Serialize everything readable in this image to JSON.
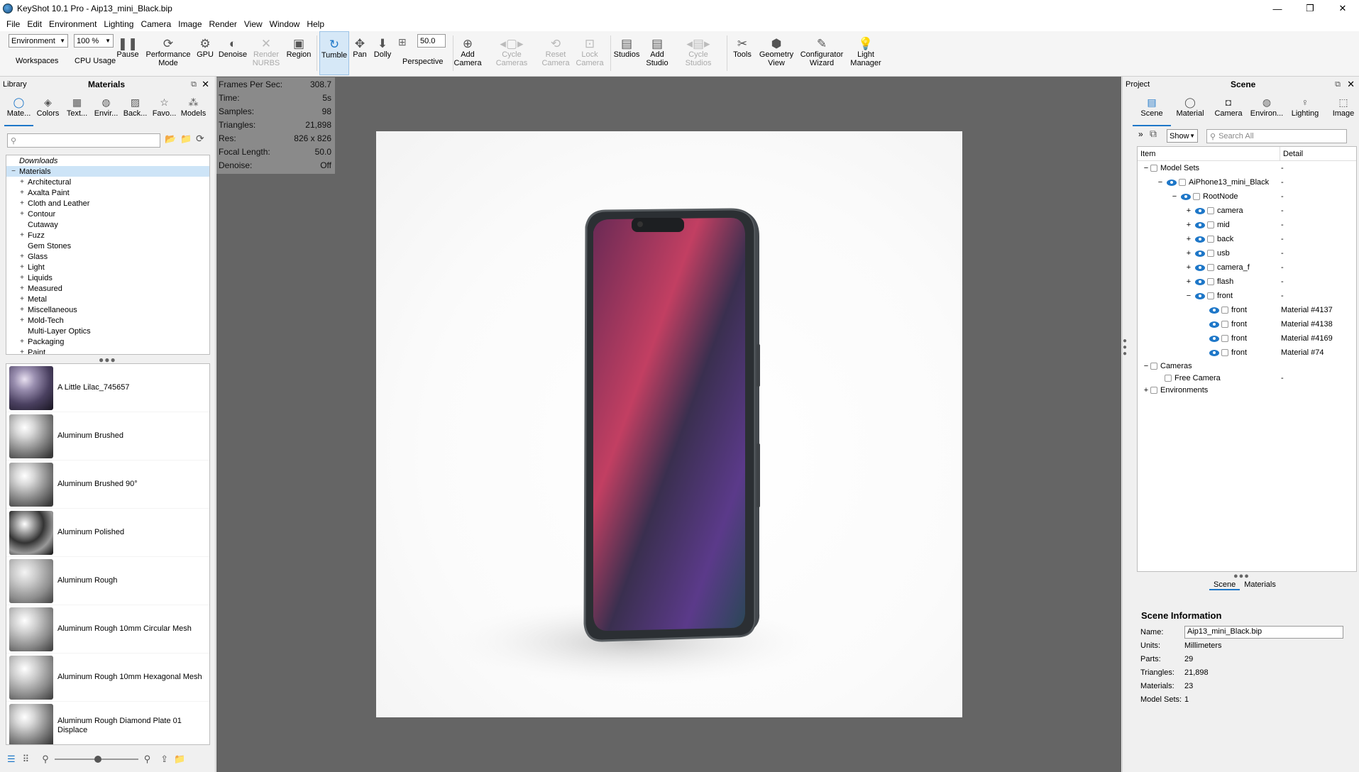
{
  "window": {
    "title": "KeyShot 10.1 Pro  - Aip13_mini_Black.bip",
    "controls": [
      "—",
      "❐",
      "✕"
    ]
  },
  "menu": [
    "File",
    "Edit",
    "Environment",
    "Lighting",
    "Camera",
    "Image",
    "Render",
    "View",
    "Window",
    "Help"
  ],
  "toolbar": {
    "workspace_select": "Environment",
    "workspace_label": "Workspaces",
    "cpu_select": "100 %",
    "cpu_label": "CPU Usage",
    "pause": "Pause",
    "performance": "Performance Mode",
    "gpu": "GPU",
    "denoise": "Denoise",
    "render_nurbs": "Render NURBS",
    "region": "Region",
    "tumble": "Tumble",
    "pan": "Pan",
    "dolly": "Dolly",
    "focal_value": "50.0",
    "perspective": "Perspective",
    "add_camera": "Add Camera",
    "cycle_cameras": "Cycle Cameras",
    "reset_camera": "Reset Camera",
    "lock_camera": "Lock Camera",
    "studios": "Studios",
    "add_studio": "Add Studio",
    "cycle_studios": "Cycle Studios",
    "tools": "Tools",
    "geometry_view": "Geometry View",
    "configurator": "Configurator Wizard",
    "light_manager": "Light Manager"
  },
  "library": {
    "panel_label": "Library",
    "title": "Materials",
    "tabs": [
      "Mate...",
      "Colors",
      "Text...",
      "Envir...",
      "Back...",
      "Favo...",
      "Models"
    ],
    "tree": [
      {
        "label": "Downloads",
        "pm": "",
        "italic": true
      },
      {
        "label": "Materials",
        "pm": "−",
        "selected": true
      },
      {
        "label": "Architectural",
        "pm": "+"
      },
      {
        "label": "Axalta Paint",
        "pm": "+"
      },
      {
        "label": "Cloth and Leather",
        "pm": "+"
      },
      {
        "label": "Contour",
        "pm": "+"
      },
      {
        "label": "Cutaway",
        "pm": ""
      },
      {
        "label": "Fuzz",
        "pm": "+"
      },
      {
        "label": "Gem Stones",
        "pm": ""
      },
      {
        "label": "Glass",
        "pm": "+"
      },
      {
        "label": "Light",
        "pm": "+"
      },
      {
        "label": "Liquids",
        "pm": "+"
      },
      {
        "label": "Measured",
        "pm": "+"
      },
      {
        "label": "Metal",
        "pm": "+"
      },
      {
        "label": "Miscellaneous",
        "pm": "+"
      },
      {
        "label": "Mold-Tech",
        "pm": "+"
      },
      {
        "label": "Multi-Layer Optics",
        "pm": ""
      },
      {
        "label": "Packaging",
        "pm": "+"
      },
      {
        "label": "Paint",
        "pm": "+"
      }
    ],
    "materials": [
      "A Little Lilac_745657",
      "Aluminum Brushed",
      "Aluminum Brushed 90°",
      "Aluminum Polished",
      "Aluminum Rough",
      "Aluminum Rough 10mm Circular Mesh",
      "Aluminum Rough 10mm Hexagonal Mesh",
      "Aluminum Rough Diamond Plate 01 Displace"
    ]
  },
  "hud": [
    {
      "k": "Frames Per Sec:",
      "v": "308.7"
    },
    {
      "k": "Time:",
      "v": "5s"
    },
    {
      "k": "Samples:",
      "v": "98"
    },
    {
      "k": "Triangles:",
      "v": "21,898"
    },
    {
      "k": "Res:",
      "v": "826 x 826"
    },
    {
      "k": "Focal Length:",
      "v": "50.0"
    },
    {
      "k": "Denoise:",
      "v": "Off"
    }
  ],
  "project": {
    "panel_label": "Project",
    "title": "Scene",
    "tabs": [
      "Scene",
      "Material",
      "Camera",
      "Environ...",
      "Lighting",
      "Image"
    ],
    "show": "Show",
    "search_placeholder": "Search All",
    "col_item": "Item",
    "col_detail": "Detail",
    "rows": [
      {
        "label": "Model Sets",
        "detail": "-",
        "pm": "−",
        "indent": 0,
        "eye": false
      },
      {
        "label": "AiPhone13_mini_Black",
        "detail": "-",
        "pm": "−",
        "indent": 1,
        "eye": true
      },
      {
        "label": "RootNode",
        "detail": "-",
        "pm": "−",
        "indent": 2,
        "eye": true
      },
      {
        "label": "camera",
        "detail": "-",
        "pm": "+",
        "indent": 3,
        "eye": true
      },
      {
        "label": "mid",
        "detail": "-",
        "pm": "+",
        "indent": 3,
        "eye": true
      },
      {
        "label": "back",
        "detail": "-",
        "pm": "+",
        "indent": 3,
        "eye": true
      },
      {
        "label": "usb",
        "detail": "-",
        "pm": "+",
        "indent": 3,
        "eye": true
      },
      {
        "label": "camera_f",
        "detail": "-",
        "pm": "+",
        "indent": 3,
        "eye": true
      },
      {
        "label": "flash",
        "detail": "-",
        "pm": "+",
        "indent": 3,
        "eye": true
      },
      {
        "label": "front",
        "detail": "-",
        "pm": "−",
        "indent": 3,
        "eye": true
      },
      {
        "label": "front",
        "detail": "Material #4137",
        "pm": "",
        "indent": 4,
        "eye": true
      },
      {
        "label": "front",
        "detail": "Material #4138",
        "pm": "",
        "indent": 4,
        "eye": true
      },
      {
        "label": "front",
        "detail": "Material #4169",
        "pm": "",
        "indent": 4,
        "eye": true
      },
      {
        "label": "front",
        "detail": "Material #74",
        "pm": "",
        "indent": 4,
        "eye": true
      },
      {
        "label": "Cameras",
        "detail": "",
        "pm": "−",
        "indent": 0,
        "eye": false
      },
      {
        "label": "Free Camera",
        "detail": "-",
        "pm": "",
        "indent": 1,
        "eye": false
      },
      {
        "label": "Environments",
        "detail": "",
        "pm": "+",
        "indent": 0,
        "eye": false
      }
    ],
    "bottom_tabs": [
      "Scene",
      "Materials"
    ],
    "info_title": "Scene Information",
    "info": [
      {
        "k": "Name:",
        "v": "Aip13_mini_Black.bip"
      },
      {
        "k": "Units:",
        "v": "Millimeters"
      },
      {
        "k": "Parts:",
        "v": "29"
      },
      {
        "k": "Triangles:",
        "v": "21,898"
      },
      {
        "k": "Materials:",
        "v": "23"
      },
      {
        "k": "Model Sets:",
        "v": "1"
      }
    ]
  },
  "colors": {
    "accent": "#1e77c8",
    "viewport_bg": "#656565"
  }
}
